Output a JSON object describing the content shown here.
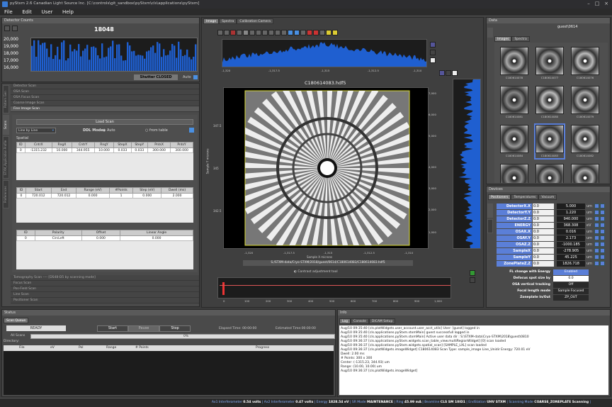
{
  "window": {
    "title": "pyStxm 2.6 Canadian Light Source Inc. [C:\\controls\\git_sandbox\\pyStxm\\cls\\applications\\pyStxm]"
  },
  "menu": [
    "File",
    "Edit",
    "User",
    "Help"
  ],
  "detector": {
    "header": "Detector Counts",
    "value": "18048",
    "y_ticks": [
      "20,000",
      "19,000",
      "18,000",
      "17,000",
      "16,000"
    ],
    "shutter_label": "Shutter",
    "shutter_state": "CLOSED",
    "auto_label": "Auto"
  },
  "scans": {
    "top_items": [
      "Detector Scan",
      "OSA Scan",
      "OSA Focus Scan",
      "Coarse Image Scan",
      "Fine Image Scan"
    ],
    "vtabs": [
      "Pattern Gen",
      "Scans",
      "STXM_Application Profile",
      "Preferences"
    ],
    "load_scan": "Load Scan",
    "line_mode": "Line by Line",
    "ddl_mode": "DDL Mode",
    "auto": "Auto",
    "from_table": "from table",
    "spatial_label": "Spatial",
    "spatial_headers": [
      "ID",
      "CntrX",
      "RngX",
      "CntrY",
      "RngY",
      "StepX",
      "StepY",
      "PntsX",
      "PntsY"
    ],
    "spatial_row": [
      "0",
      "-1315.232",
      "10.000",
      "344.955",
      "10.000",
      "0.033",
      "0.033",
      "300.000",
      "300.000"
    ],
    "energy_headers": [
      "ID",
      "Start",
      "End",
      "Range (eV)",
      "#Points",
      "Step (eV)",
      "Dwell (ms)"
    ],
    "energy_row": [
      "0",
      "720.012",
      "720.012",
      "0.000",
      "1",
      "0.000",
      "2.000"
    ],
    "pol_headers": [
      "ID",
      "Polarity",
      "Offset",
      "Linear Angle"
    ],
    "pol_row": [
      "0",
      "CircLeft",
      "0.000",
      "0.000"
    ],
    "bottom_items": [
      "Tomography Scan  ----  [DS48-D5 by scanning mode]",
      "Focus Scan",
      "Pos-Field Scan",
      "Line Scan",
      "Positioner Scan"
    ]
  },
  "image": {
    "tabs": [
      "Image",
      "Spectra",
      "Calibration Camera"
    ],
    "filename": "C180614083.hdf5",
    "hist_y": [
      "4,000",
      "3,000",
      "2,000",
      "1,000"
    ],
    "hist_x": [
      "-1,320",
      "-1,317.5",
      "-1,315",
      "-1,312.5",
      "-1,310"
    ],
    "x_ticks": [
      "-1,320",
      "-1,317.5",
      "-1,315",
      "-1,312.5",
      "-1,310"
    ],
    "x_label": "Sample X microns",
    "y_ticks": [
      "347.5",
      "345",
      "342.5"
    ],
    "y_label": "Sample Y microns",
    "r_ticks": [
      "7,000",
      "6,000",
      "5,000",
      "4,000",
      "3,000",
      "2,000",
      "1,000"
    ],
    "path": "S:/STXM-data/Cryo-STXM/2018/guest/0614/C180614083/C180614083.hdf5",
    "contrast_label": "Contrast adjustment tool",
    "z_ticks": [
      "0",
      "100",
      "200",
      "300",
      "400",
      "500",
      "600",
      "700",
      "800",
      "900",
      "1,000"
    ]
  },
  "data": {
    "header": "Data",
    "path": "guest\\0614",
    "tabs": [
      "Images",
      "Spectra"
    ],
    "thumbs": [
      "C180614078",
      "C180614077",
      "C180614076",
      "C180614081",
      "C180614080",
      "C180614079",
      "C180614084",
      "C180614083",
      "C180614082",
      "",
      "",
      ""
    ]
  },
  "devices": {
    "header": "Devices",
    "tabs": [
      "Positioners",
      "Temperatures",
      "Vacuum"
    ],
    "rows": [
      {
        "name": "DetectorX.X",
        "inp": "0.0",
        "val": "5.000",
        "unit": "um"
      },
      {
        "name": "DetectorY.Y",
        "inp": "0.0",
        "val": "1.220",
        "unit": "um"
      },
      {
        "name": "DetectorZ.Z",
        "inp": "0.0",
        "val": "940.000",
        "unit": "um"
      },
      {
        "name": "ENERGY",
        "inp": "0.0",
        "val": "368.308",
        "unit": "eV"
      },
      {
        "name": "OSAX.X",
        "inp": "0.0",
        "val": "0.016",
        "unit": "um"
      },
      {
        "name": "OSAY.Y",
        "inp": "0.0",
        "val": "2.173",
        "unit": "um"
      },
      {
        "name": "OSAZ.Z",
        "inp": "0.0",
        "val": "-1000.185",
        "unit": "um"
      },
      {
        "name": "SampleX",
        "inp": "0.0",
        "val": "-278.905",
        "unit": "um"
      },
      {
        "name": "SampleY",
        "inp": "0.0",
        "val": "45.225",
        "unit": "um"
      },
      {
        "name": "ZonePlateZ.Z",
        "inp": "0.0",
        "val": "1826.718",
        "unit": "um"
      }
    ],
    "settings": [
      {
        "label": "FL change with Energy",
        "val": "Enabled"
      },
      {
        "label": "Defocus spot size by",
        "val": "0.0"
      },
      {
        "label": "OSA vertical tracking",
        "val": "Off"
      },
      {
        "label": "Focal length mode",
        "val": "Sample Focused"
      },
      {
        "label": "Zoneplate In/Out",
        "val": "ZP_OUT"
      }
    ]
  },
  "status": {
    "header": "Status",
    "tab": "Scan Queue",
    "ready": "READY",
    "start": "Start",
    "pause": "Pause",
    "stop": "Stop",
    "elapsed": "Elapsed Time: 00:00:00",
    "estimated": "Estimated Time:00:00:00",
    "all_scans": "All Scans",
    "progress": "0%",
    "directory": "Directory:",
    "cols": [
      "File",
      "eV",
      "Pol",
      "Range",
      "# Points",
      "Progress"
    ]
  },
  "info": {
    "header": "Info",
    "tabs": [
      "Log",
      "Console",
      "DICAM Setup"
    ],
    "lines": [
      "Aug/10 09:35:40 [cls.plotWidgets.user_account.user_acct_utils] User: [guest] logged in",
      "Aug/10 09:35:40 [cls.applications.pyStxm.stxmMain] guest successfull logged in",
      "Aug/10 09:35:40 [cls.applications.pyStxm.stxmMain] Active user data dir : S:\\STXM-data\\Cryo-STXM\\2018\\guest\\0810",
      "Aug/10 09:36:37 [cls.applications.pyStxm.widgets.scan_table_view.multiRegionWidget] [0] scan loaded",
      "Aug/10 09:36:37 [cls.applications.pyStxm.widgets.spatial_scan] [SAMPLE_LXL] scan loaded",
      "Aug/10 09:36:37 [cls.plotWidgets.imageWidget] C180614083  Scan Type: sample_image Line_Unidir  Energy: 720.01 eV",
      "   Dwell: 2.00 ms",
      "   # Points: 300 x 300",
      "   Center: (-1315.23, 344.93) um",
      "   Range: (10.00, 10.00) um",
      "Aug/10 09:36:37 [cls.plotWidgets.imageWidget]"
    ]
  },
  "statusbar": [
    {
      "k": "Ax1 Interferometer",
      "v": "0.54 volts"
    },
    {
      "k": "Ax2 Interferometer",
      "v": "0.47 volts"
    },
    {
      "k": "Energy",
      "v": "1828.54 eV"
    },
    {
      "k": "SR Mode",
      "v": "MAINTENANCE"
    },
    {
      "k": "Ring",
      "v": "45.99 mA"
    },
    {
      "k": "Beamline",
      "v": "CLS SM 10ID1"
    },
    {
      "k": "EndStation",
      "v": "UHV STXM"
    },
    {
      "k": "Scanning Mode",
      "v": "COARSE_ZONEPLATE Scanning"
    }
  ],
  "colors": {
    "accent": "#5b7fd8",
    "plot_fill": "#1f5fd0",
    "enabled": "#5b7fd8"
  }
}
